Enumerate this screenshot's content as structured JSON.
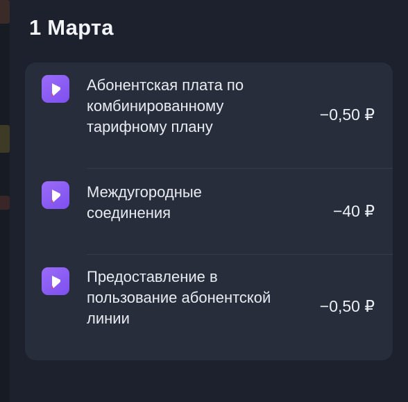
{
  "date_title": "1 Марта",
  "transactions": [
    {
      "icon": "operator-logo-icon",
      "description_lines": [
        "Абонентская плата по",
        "комбинированному",
        "тарифному плану"
      ],
      "amount": "−0,50 ₽"
    },
    {
      "icon": "operator-logo-icon",
      "description_lines": [
        "Междугородные",
        "соединения"
      ],
      "amount": "−40 ₽"
    },
    {
      "icon": "operator-logo-icon",
      "description_lines": [
        "Предоставление в",
        "пользование абонентской",
        "линии"
      ],
      "amount": "−0,50 ₽"
    }
  ],
  "colors": {
    "background": "#1c212d",
    "card": "#272d3a",
    "icon_gradient_start": "#9b6cf7",
    "icon_gradient_end": "#7d4ff0",
    "icon_accent": "#e8453c"
  }
}
